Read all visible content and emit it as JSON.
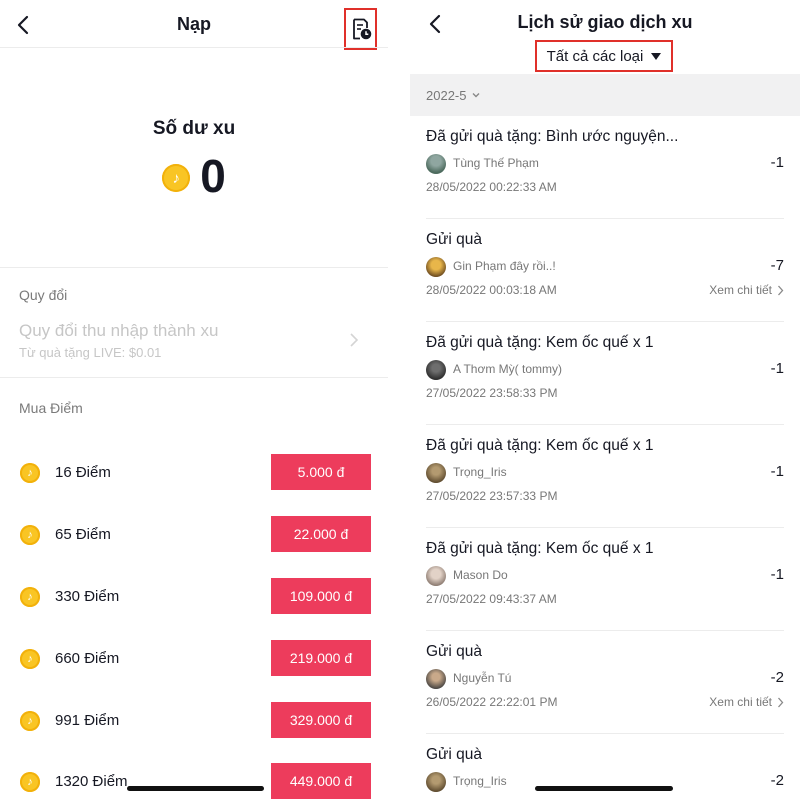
{
  "left": {
    "title": "Nạp",
    "balance": {
      "label": "Số dư xu",
      "value": "0"
    },
    "exchange": {
      "section_label": "Quy đổi",
      "title": "Quy đổi thu nhập thành xu",
      "subtitle": "Từ quà tặng LIVE: $0.01"
    },
    "purchase": {
      "section_label": "Mua Điểm",
      "packages": [
        {
          "label": "16 Điểm",
          "price": "5.000 đ"
        },
        {
          "label": "65 Điểm",
          "price": "22.000 đ"
        },
        {
          "label": "330 Điểm",
          "price": "109.000 đ"
        },
        {
          "label": "660 Điểm",
          "price": "219.000 đ"
        },
        {
          "label": "991 Điểm",
          "price": "329.000 đ"
        },
        {
          "label": "1320 Điểm",
          "price": "449.000 đ"
        }
      ]
    }
  },
  "right": {
    "title": "Lịch sử giao dịch xu",
    "filter_label": "Tất cả các loại",
    "month": "2022-5",
    "transactions": [
      {
        "title": "Đã gửi quà tặng: Bình ước nguyện...",
        "user": "Tùng Thế Phạm",
        "amount": "-1",
        "date": "28/05/2022 00:22:33 AM",
        "detail": ""
      },
      {
        "title": "Gửi quà",
        "user": "Gin Phạm đây rồi..!",
        "amount": "-7",
        "date": "28/05/2022 00:03:18 AM",
        "detail": "Xem chi tiết"
      },
      {
        "title": "Đã gửi quà tặng: Kem ốc quế x 1",
        "user": "A Thơm Mỳ( tommy)",
        "amount": "-1",
        "date": "27/05/2022 23:58:33 PM",
        "detail": ""
      },
      {
        "title": "Đã gửi quà tặng: Kem ốc quế x 1",
        "user": "Trọng_Iris",
        "amount": "-1",
        "date": "27/05/2022 23:57:33 PM",
        "detail": ""
      },
      {
        "title": "Đã gửi quà tặng: Kem ốc quế x 1",
        "user": "Mason Do",
        "amount": "-1",
        "date": "27/05/2022 09:43:37 AM",
        "detail": ""
      },
      {
        "title": "Gửi quà",
        "user": "Nguyễn Tú",
        "amount": "-2",
        "date": "26/05/2022 22:22:01 PM",
        "detail": "Xem chi tiết"
      },
      {
        "title": "Gửi quà",
        "user": "Trọng_Iris",
        "amount": "-2",
        "date": "",
        "detail": ""
      }
    ]
  },
  "icons": {
    "back": "back-arrow-icon",
    "history": "transaction-history-icon",
    "coin": "tiktok-coin-icon",
    "chevron": "chevron-right-icon",
    "dropdown": "caret-down-icon"
  },
  "colors": {
    "price_button": "#ed3c5c",
    "highlight_box": "#e0302a",
    "coin": "#f9c524",
    "month_bar": "#f1f1f2"
  }
}
